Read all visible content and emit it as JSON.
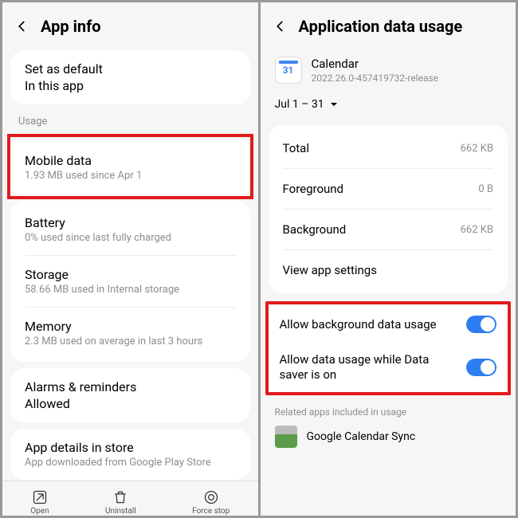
{
  "left": {
    "header": {
      "title": "App info"
    },
    "set_default": {
      "title": "Set as default",
      "sub": "In this app"
    },
    "usage_label": "Usage",
    "mobile_data": {
      "title": "Mobile data",
      "sub": "1.93 MB used since Apr 1"
    },
    "battery": {
      "title": "Battery",
      "sub": "0% used since last fully charged"
    },
    "storage": {
      "title": "Storage",
      "sub": "58.66 MB used in Internal storage"
    },
    "memory": {
      "title": "Memory",
      "sub": "2.3 MB used on average in last 3 hours"
    },
    "alarms": {
      "title": "Alarms & reminders",
      "sub": "Allowed"
    },
    "store": {
      "title": "App details in store",
      "sub": "App downloaded from Google Play Store"
    },
    "bottom": {
      "open": "Open",
      "uninstall": "Uninstall",
      "force": "Force stop"
    }
  },
  "right": {
    "header": {
      "title": "Application data usage"
    },
    "app": {
      "name": "Calendar",
      "version": "2022.26.0-457419732-release"
    },
    "range": "Jul 1 – 31",
    "total": {
      "label": "Total",
      "value": "662 KB"
    },
    "foreground": {
      "label": "Foreground",
      "value": "0 B"
    },
    "background": {
      "label": "Background",
      "value": "662 KB"
    },
    "view_settings": "View app settings",
    "allow_bg": "Allow background data usage",
    "allow_saver": "Allow data usage while Data saver is on",
    "related_label": "Related apps included in usage",
    "related_app": "Google Calendar Sync"
  }
}
